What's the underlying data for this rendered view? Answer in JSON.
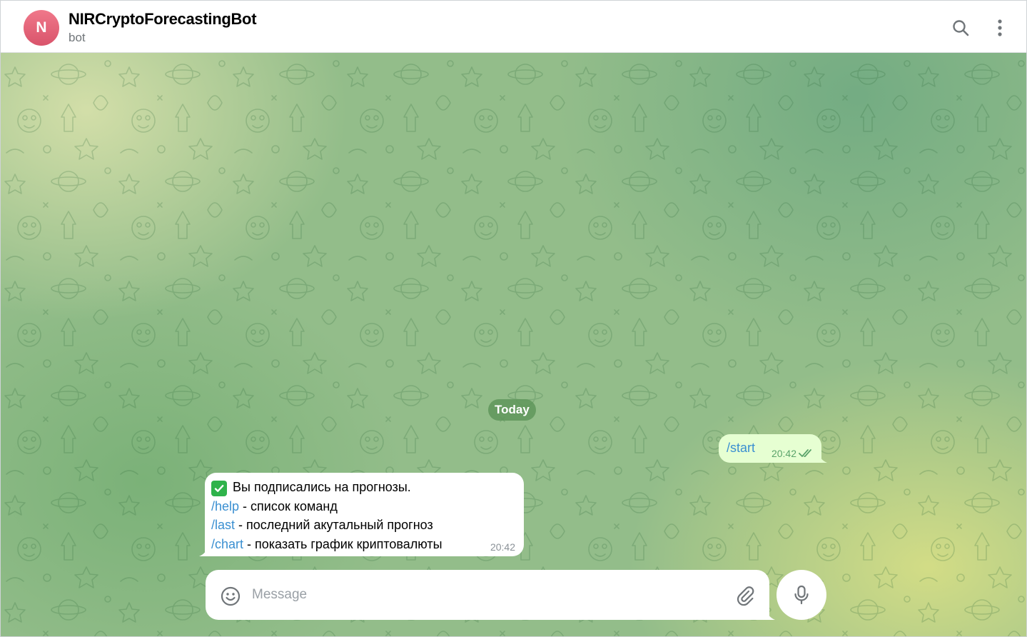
{
  "header": {
    "avatar_letter": "N",
    "title": "NIRCryptoForecastingBot",
    "subtitle": "bot",
    "search_icon": "search-icon",
    "more_icon": "more-vertical-icon"
  },
  "chat": {
    "date_label": "Today",
    "outgoing": {
      "text": "/start",
      "time": "20:42",
      "status": "read"
    },
    "incoming": {
      "intro": "Вы подписались на прогнозы.",
      "lines": [
        {
          "command": "/help",
          "description": " - список команд"
        },
        {
          "command": "/last",
          "description": " - последний акутальный прогноз"
        },
        {
          "command": "/chart",
          "description": " - показать график криптовалюты"
        }
      ],
      "time": "20:42"
    }
  },
  "composer": {
    "placeholder": "Message",
    "emoji_icon": "smile-icon",
    "attach_icon": "paperclip-icon",
    "mic_icon": "microphone-icon"
  },
  "colors": {
    "avatar": "#e0607a",
    "outgoing_bubble": "#e6ffd2",
    "command_link": "#3a8fd1",
    "read_check": "#5aa36a",
    "check_emoji": "#2fb34b"
  }
}
